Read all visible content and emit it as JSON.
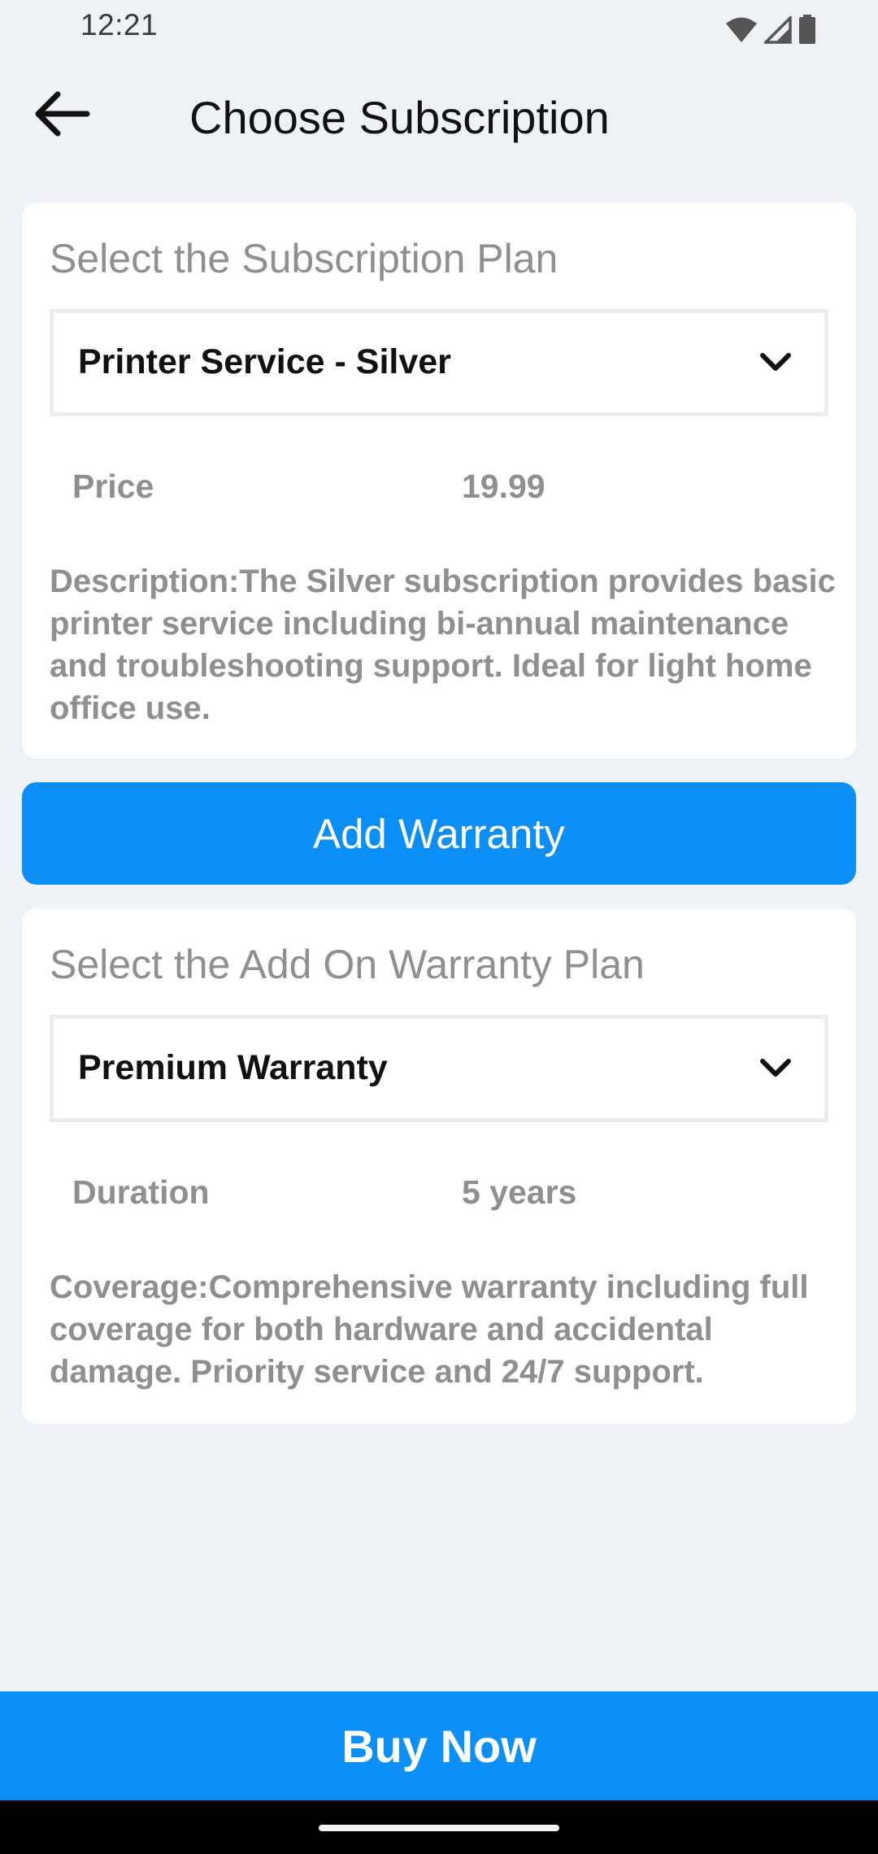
{
  "status_bar": {
    "time": "12:21",
    "icons": [
      "wifi-icon",
      "signal-icon",
      "battery-icon"
    ]
  },
  "app_bar": {
    "back_icon": "arrow-left-icon",
    "title": "Choose Subscription"
  },
  "subscription": {
    "heading": "Select the Subscription Plan",
    "selected_plan": "Printer Service - Silver",
    "price_label": "Price",
    "price_value": "19.99",
    "description": "Description:The Silver subscription provides basic printer service including bi-annual maintenance and troubleshooting support. Ideal for light home office use."
  },
  "add_warranty": {
    "label": "Add Warranty"
  },
  "warranty": {
    "heading": "Select the Add On Warranty Plan",
    "selected_plan": "Premium Warranty",
    "duration_label": "Duration",
    "duration_value": "5 years",
    "coverage": "Coverage:Comprehensive warranty including full coverage for both hardware and accidental damage. Priority service and 24/7 support."
  },
  "buy_now": {
    "label": "Buy Now"
  },
  "colors": {
    "accent": "#0a8ef8",
    "background": "#eef1f6",
    "card": "#ffffff",
    "muted_text": "#8f8f8f"
  }
}
